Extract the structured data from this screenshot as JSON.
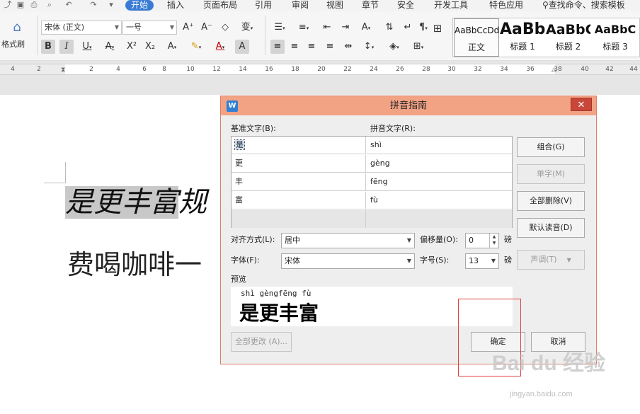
{
  "menubar": {
    "items": [
      "开始",
      "插入",
      "页面布局",
      "引用",
      "审阅",
      "视图",
      "章节",
      "安全",
      "开发工具",
      "特色应用"
    ],
    "active_item": "开始",
    "search": "查找命令、搜索模板"
  },
  "ribbon": {
    "format_painter": "格式刷",
    "font_name": "宋体 (正文)",
    "font_size": "一号",
    "styles": [
      {
        "preview": "AaBbCcDd",
        "name": "正文"
      },
      {
        "preview": "AaBb",
        "name": "标题 1"
      },
      {
        "preview": "AaBbC",
        "name": "标题 2"
      },
      {
        "preview": "AaBbC",
        "name": "标题 3"
      }
    ]
  },
  "ruler": {
    "ticks": [
      "4",
      "2",
      "2",
      "4",
      "6",
      "8",
      "10",
      "12",
      "14",
      "16",
      "18",
      "20",
      "22",
      "24",
      "26",
      "28",
      "30",
      "32",
      "34",
      "36",
      "38",
      "40",
      "42",
      "44",
      "46"
    ]
  },
  "document": {
    "line1_highlight": "是更丰富",
    "line1_rest": "规",
    "line2": "费喝咖啡一"
  },
  "dialog": {
    "title": "拼音指南",
    "base_text_label": "基准文字(B):",
    "pinyin_label": "拼音文字(R):",
    "rows": [
      {
        "base": "是",
        "pinyin": "shì"
      },
      {
        "base": "更",
        "pinyin": "gèng"
      },
      {
        "base": "丰",
        "pinyin": "fēng"
      },
      {
        "base": "富",
        "pinyin": "fù"
      }
    ],
    "buttons": {
      "combine": "组合(G)",
      "single": "单字(M)",
      "delete_all": "全部删除(V)",
      "default_reading": "默认读音(D)",
      "tone": "声调(T)",
      "change_all": "全部更改 (A)...",
      "ok": "确定",
      "cancel": "取消"
    },
    "align_label": "对齐方式(L):",
    "align_value": "居中",
    "offset_label": "偏移量(O):",
    "offset_value": "0",
    "offset_unit": "磅",
    "font_label": "字体(F):",
    "font_value": "宋体",
    "size_label": "字号(S):",
    "size_value": "13",
    "size_unit": "磅",
    "preview_label": "预览",
    "preview_pinyin": "shì gèngfēng fù",
    "preview_text": "是更丰富"
  },
  "watermark": {
    "brand": "Bai du 经验",
    "url": "jingyan.baidu.com"
  }
}
